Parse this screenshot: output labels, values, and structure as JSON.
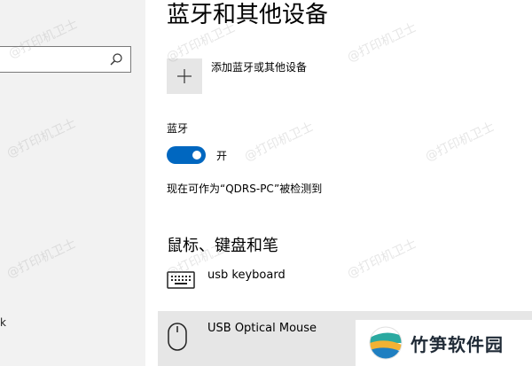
{
  "sidebar": {
    "search": {
      "placeholder": "",
      "icon": "search-icon"
    },
    "partial_item": "k"
  },
  "main": {
    "page_title": "蓝牙和其他设备",
    "add_device": {
      "label": "添加蓝牙或其他设备",
      "icon": "plus-icon"
    },
    "bluetooth": {
      "label": "蓝牙",
      "toggle_state": "开",
      "on": true,
      "accent": "#0067c0"
    },
    "discoverable_text": "现在可作为“QDRS-PC”被检测到",
    "section_title": "鼠标、键盘和笔",
    "devices": [
      {
        "name": "usb keyboard",
        "icon": "keyboard-icon"
      },
      {
        "name": "USB Optical Mouse",
        "icon": "mouse-icon",
        "selected": true
      }
    ]
  },
  "watermark": {
    "text": "@打印机卫士",
    "logo_text": "竹笋软件园"
  }
}
